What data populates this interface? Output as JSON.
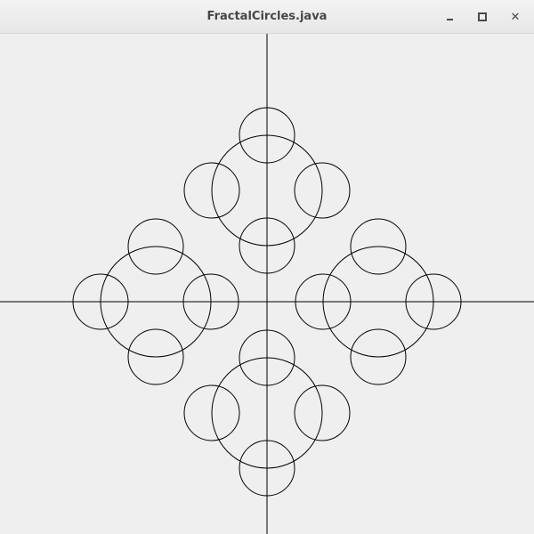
{
  "window": {
    "title": "FractalCircles.java",
    "controls": {
      "minimize_icon": "minimize-icon",
      "maximize_icon": "maximize-icon",
      "close_icon": "close-icon",
      "close_glyph": "✕"
    }
  },
  "drawing": {
    "background": "#efefef",
    "stroke": "#000000",
    "circles": [
      {
        "cx": 0,
        "cy": 0,
        "r": 0
      }
    ]
  }
}
